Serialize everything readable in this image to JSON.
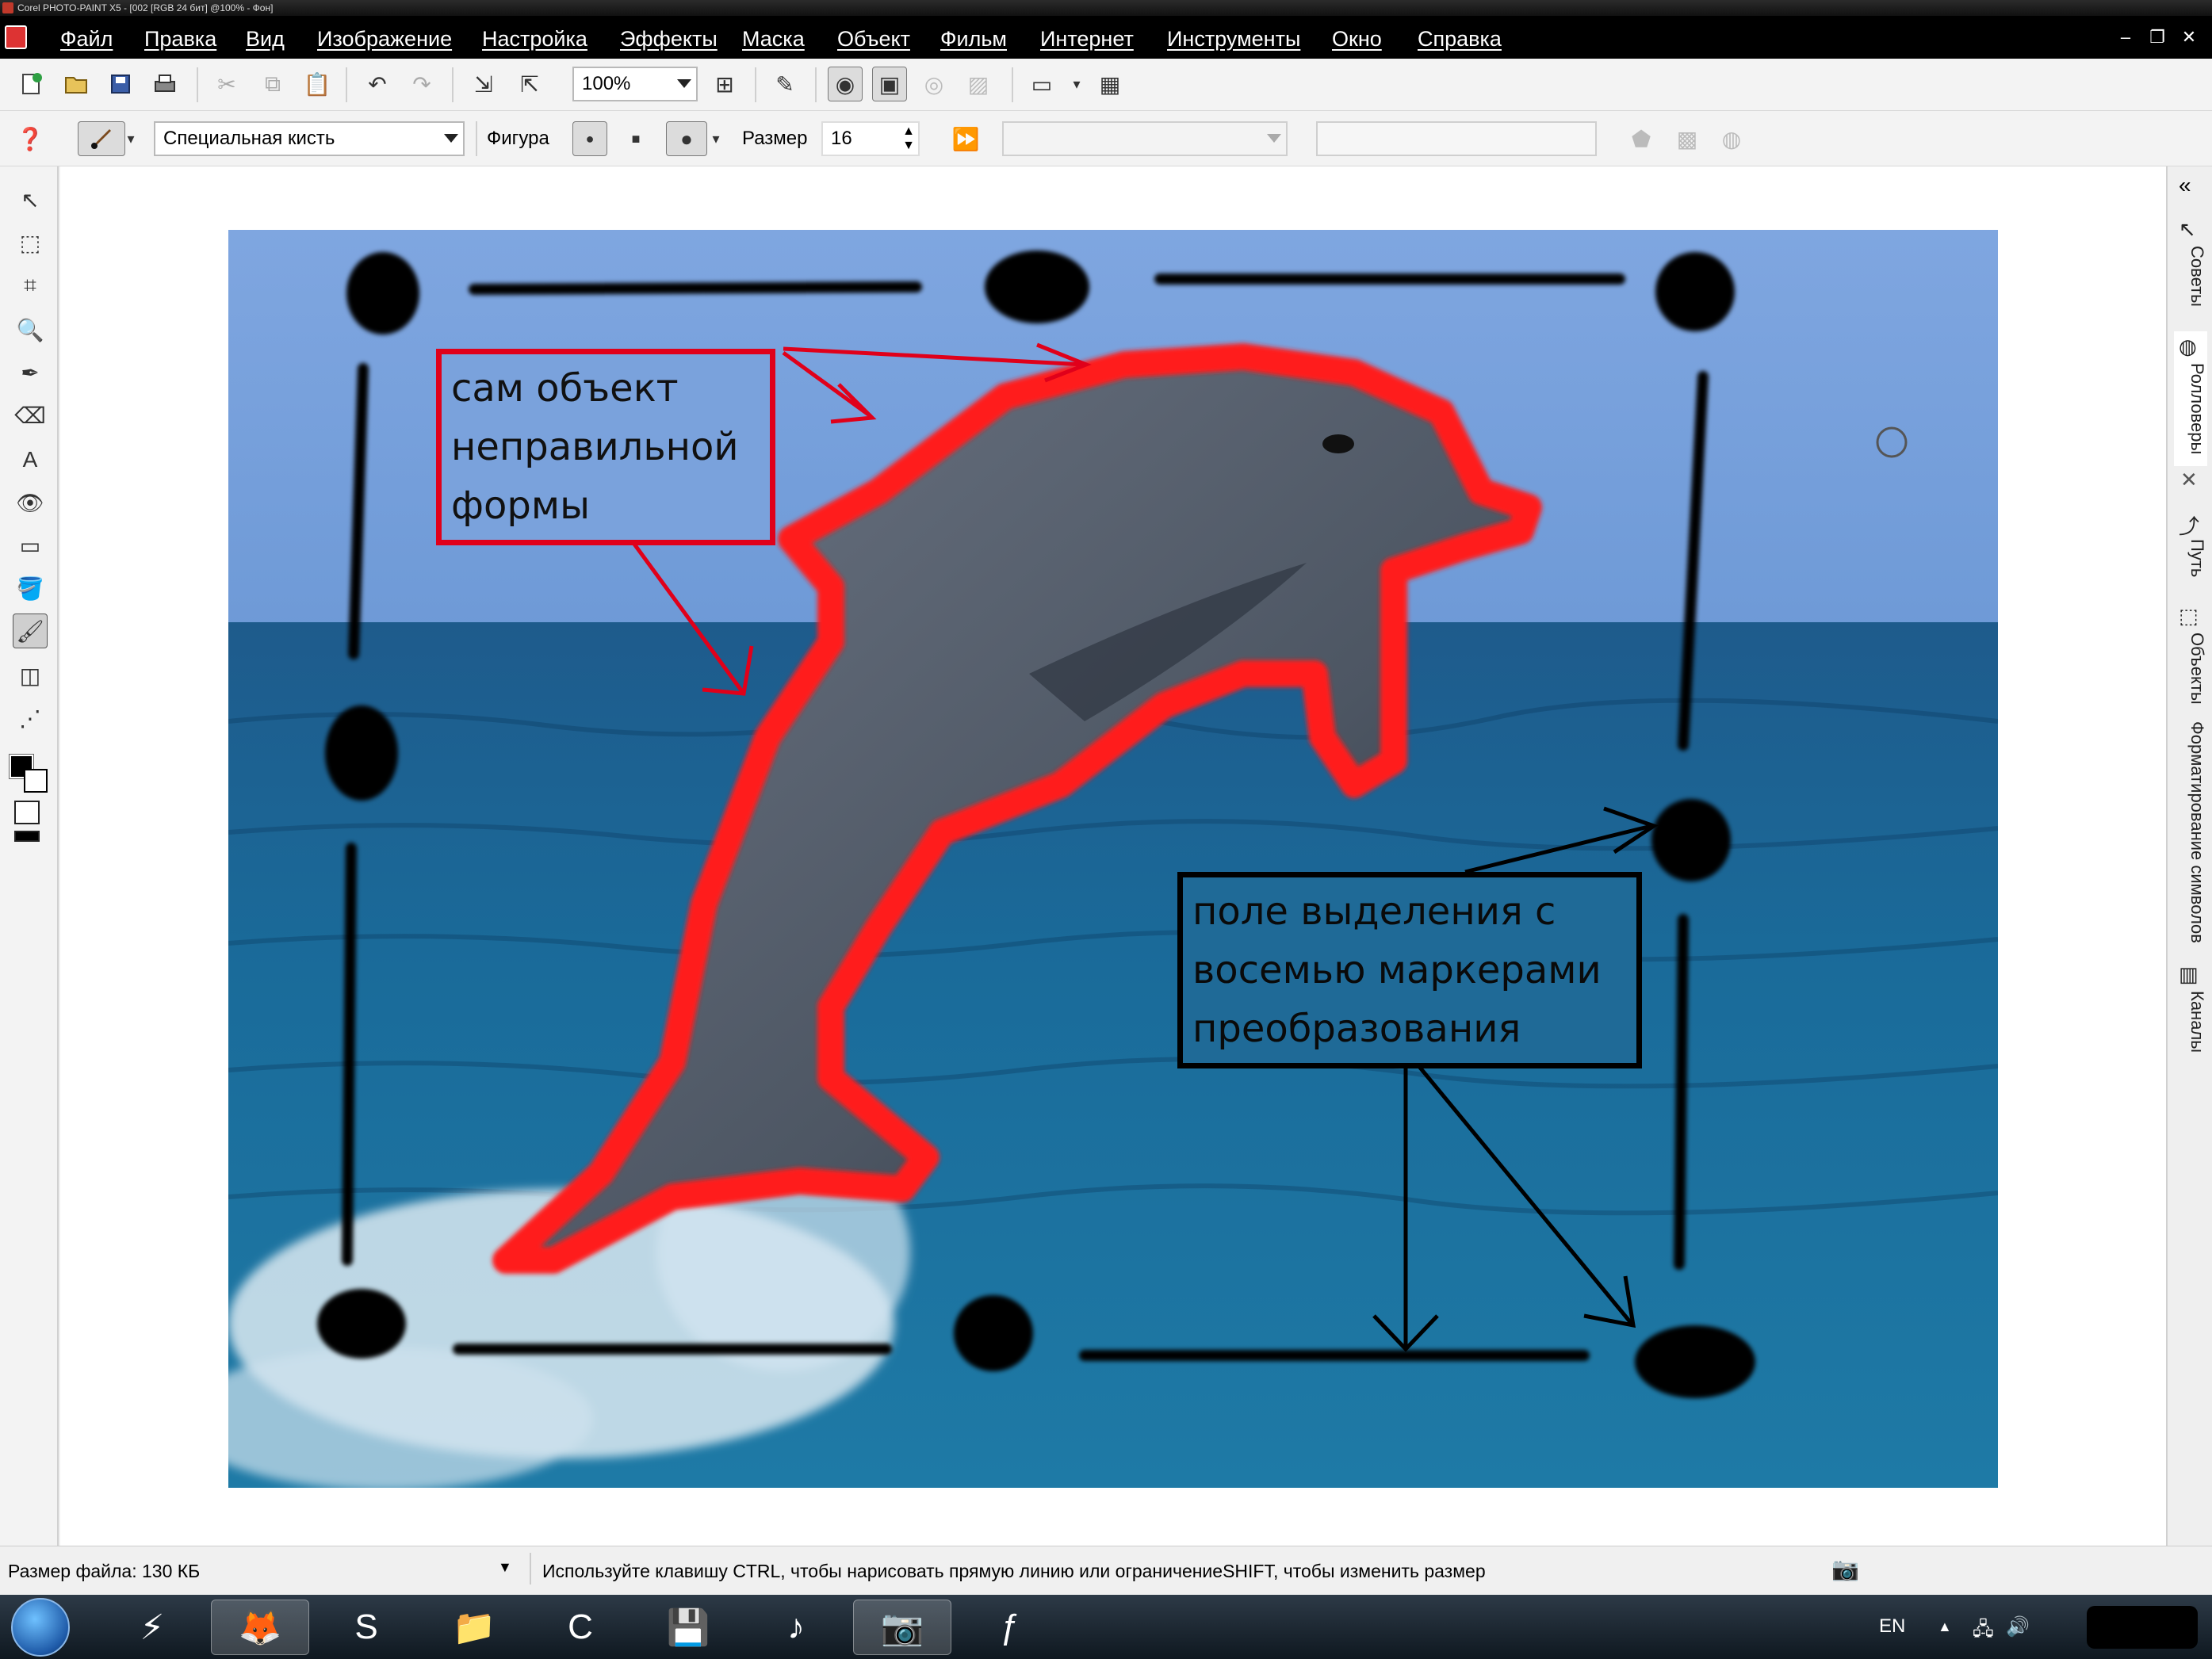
{
  "window": {
    "title": "Corel PHOTO-PAINT X5 - [002 [RGB 24 бит] @100% - Фон]"
  },
  "menu": {
    "items": [
      "Файл",
      "Правка",
      "Вид",
      "Изображение",
      "Настройка",
      "Эффекты",
      "Маска",
      "Объект",
      "Фильм",
      "Интернет",
      "Инструменты",
      "Окно",
      "Справка"
    ]
  },
  "toolbar": {
    "zoom_value": "100%"
  },
  "property_bar": {
    "brush_type": "Специальная кисть",
    "shape_label": "Фигура",
    "size_label": "Размер",
    "size_value": "16",
    "empty_combo": "",
    "empty_field": ""
  },
  "image_annotations": {
    "object_label": "сам объект\nнеправильной\nформы",
    "object_label_lines": [
      "сам объект",
      "неправильной",
      "формы"
    ],
    "selection_label_lines": [
      "поле выделения с",
      "восемью маркерами",
      "преобразования"
    ],
    "object_outline_color": "#ff1a1a",
    "selection_box_color": "#000000"
  },
  "dockers": {
    "tabs": [
      "Советы",
      "Ролловеры",
      "Путь",
      "Объекты",
      "Форматирование символов",
      "Каналы"
    ]
  },
  "status": {
    "file_size": "Размер файла: 130 КБ",
    "hint": "Используйте клавишу CTRL, чтобы нарисовать прямую линию или ограничениеSHIFT, чтобы изменить размер"
  },
  "taskbar": {
    "language": "EN"
  }
}
